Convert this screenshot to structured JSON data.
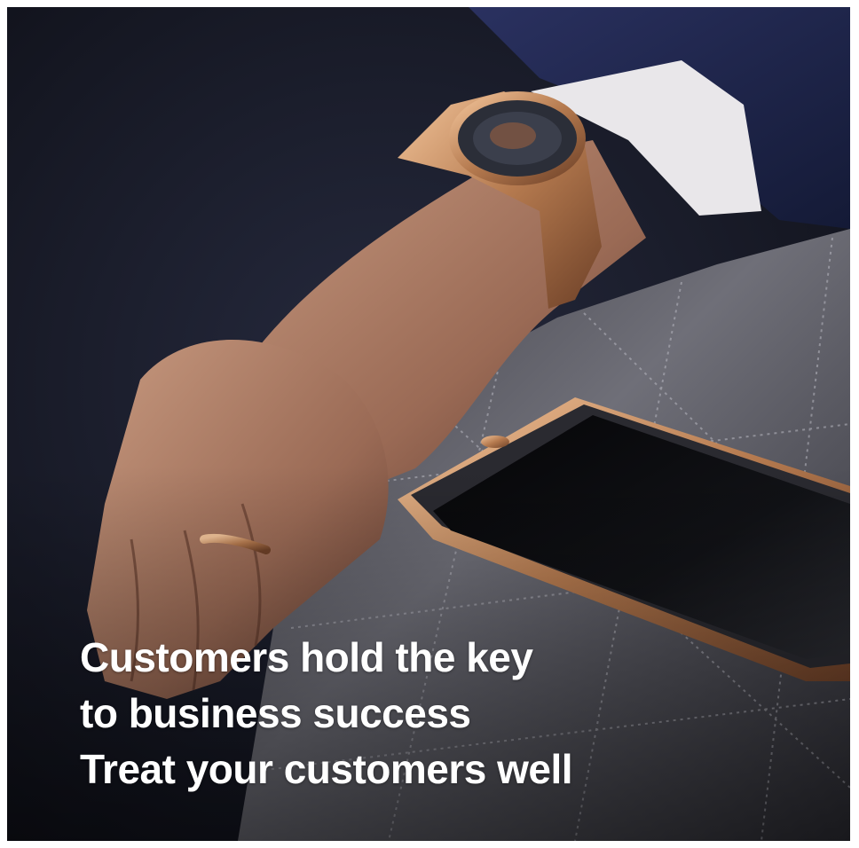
{
  "caption": {
    "lines": [
      "Customers hold the key",
      "to business success",
      "Treat your customers well"
    ]
  },
  "colors": {
    "background": "#14151d",
    "suit": "#1d2340",
    "leather": "#5e5e66",
    "gold": "#c08a5a",
    "text": "#ffffff"
  },
  "icons": [
    "watch",
    "ring",
    "smartphone"
  ]
}
